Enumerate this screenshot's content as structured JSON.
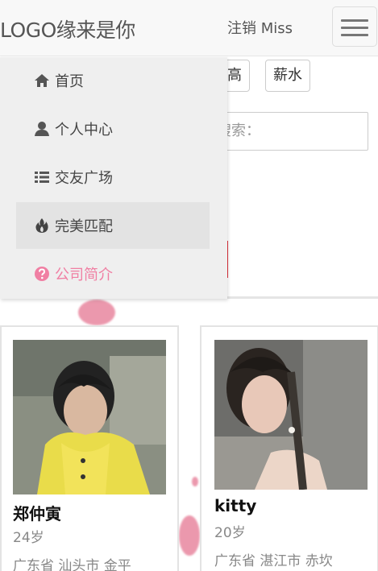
{
  "navbar": {
    "brand": "LOGO缘来是你",
    "logout_label": "注销 Miss"
  },
  "filters": {
    "buttons": [
      "高",
      "薪水"
    ],
    "search_placeholder": "搜索："
  },
  "menu": {
    "items": [
      {
        "label": "首页",
        "icon": "home-icon",
        "active": false
      },
      {
        "label": "个人中心",
        "icon": "user-icon",
        "active": false
      },
      {
        "label": "交友广场",
        "icon": "list-icon",
        "active": false
      },
      {
        "label": "完美匹配",
        "icon": "fire-icon",
        "active": true
      },
      {
        "label": "公司简介",
        "icon": "question-circle-icon",
        "active": false
      }
    ]
  },
  "profiles": [
    {
      "name": "郑仲寅",
      "age": "24岁",
      "address": "广东省 汕头市 金平"
    },
    {
      "name": "kitty",
      "age": "20岁",
      "address": "广东省 湛江市 赤坎"
    }
  ],
  "colors": {
    "menu_pink": "#f07fa3",
    "accent_red": "#e0313b",
    "navbar_bg": "#f8f8f8"
  }
}
